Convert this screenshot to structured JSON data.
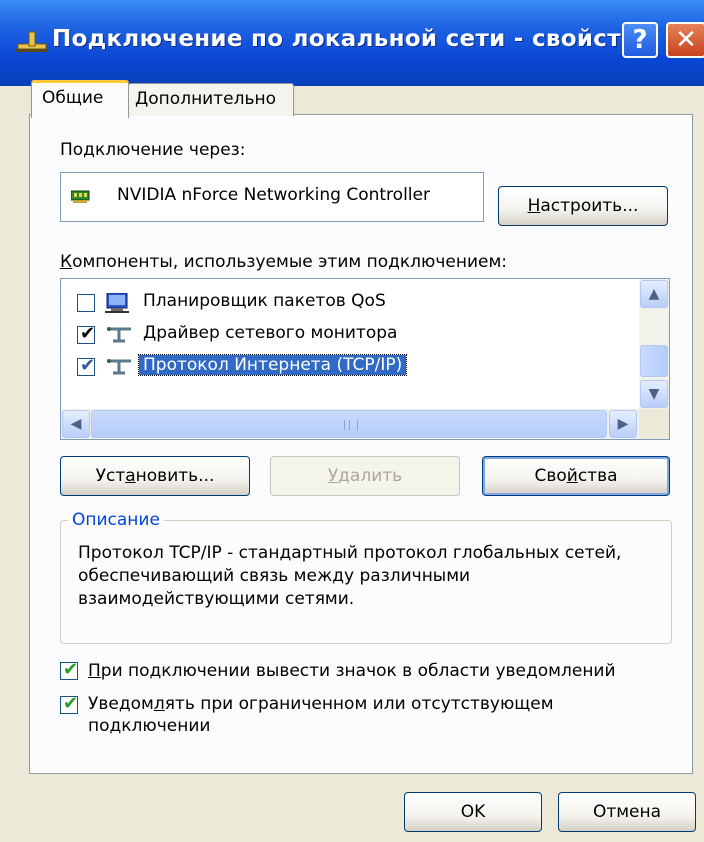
{
  "window": {
    "title": "Подключение по локальной сети - свойства",
    "help_glyph": "?",
    "close_glyph": "✕"
  },
  "tabs": [
    {
      "label": "Общие",
      "active": true
    },
    {
      "label": "Дополнительно",
      "active": false
    }
  ],
  "connect_using": {
    "label": "Подключение через:",
    "adapter": "NVIDIA nForce Networking Controller",
    "configure_button": {
      "before": "",
      "accel": "Н",
      "after": "астроить..."
    }
  },
  "components": {
    "label": {
      "before": "",
      "accel": "К",
      "after": "омпоненты, используемые этим подключением:"
    },
    "items": [
      {
        "label": "Планировщик пакетов QoS",
        "checked": false,
        "icon": "qos-scheduler-icon"
      },
      {
        "label": "Драйвер сетевого монитора",
        "checked": true,
        "icon": "network-protocol-icon"
      },
      {
        "label": "Протокол Интернета (TCP/IP)",
        "checked": true,
        "icon": "network-protocol-icon",
        "selected": true
      }
    ]
  },
  "buttons": {
    "install": {
      "before": "Уст",
      "accel": "а",
      "after": "новить..."
    },
    "uninstall": {
      "before": "",
      "accel": "У",
      "after": "далить"
    },
    "properties": {
      "before": "Сво",
      "accel": "й",
      "after": "ства"
    }
  },
  "description": {
    "legend": "Описание",
    "text": "Протокол TCP/IP - стандартный протокол глобальных сетей, обеспечивающий связь между различными взаимодействующими сетями."
  },
  "options": {
    "show_icon": {
      "before": "",
      "accel": "П",
      "after": "ри подключении вывести значок в области уведомлений",
      "checked": true
    },
    "notify": {
      "before": "Уведом",
      "accel": "л",
      "after": "ять при ограниченном или отсутствующем подключении",
      "checked": true
    }
  },
  "footer": {
    "ok": "OK",
    "cancel": "Отмена"
  },
  "colors": {
    "title_bar": "#0a46d4",
    "selection": "#316ac5",
    "legend_text": "#0046d5",
    "check_green": "#21a121"
  }
}
